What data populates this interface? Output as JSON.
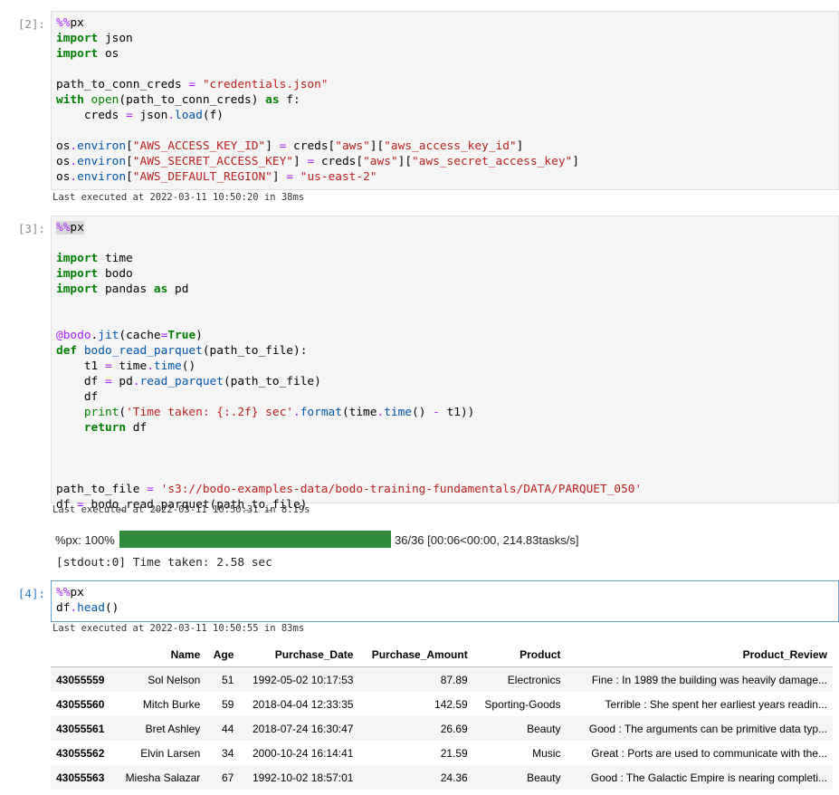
{
  "cells": [
    {
      "prompt": "[2]:",
      "lines": [
        [
          {
            "t": "%%",
            "c": "magic"
          },
          {
            "t": "px"
          }
        ],
        [
          {
            "t": "import",
            "c": "kw"
          },
          {
            "t": " json"
          }
        ],
        [
          {
            "t": "import",
            "c": "kw"
          },
          {
            "t": " os"
          }
        ],
        [],
        [
          {
            "t": "path_to_conn_creds "
          },
          {
            "t": "=",
            "c": "op"
          },
          {
            "t": " "
          },
          {
            "t": "\"credentials.json\"",
            "c": "str"
          }
        ],
        [
          {
            "t": "with",
            "c": "kw"
          },
          {
            "t": " "
          },
          {
            "t": "open",
            "c": "kw2"
          },
          {
            "t": "(path_to_conn_creds) "
          },
          {
            "t": "as",
            "c": "kw"
          },
          {
            "t": " f:"
          }
        ],
        [
          {
            "t": "    creds "
          },
          {
            "t": "=",
            "c": "op"
          },
          {
            "t": " json"
          },
          {
            "t": ".",
            "c": "op"
          },
          {
            "t": "load",
            "c": "attr"
          },
          {
            "t": "(f)"
          }
        ],
        [],
        [
          {
            "t": "os"
          },
          {
            "t": ".",
            "c": "op"
          },
          {
            "t": "environ",
            "c": "attr"
          },
          {
            "t": "["
          },
          {
            "t": "\"AWS_ACCESS_KEY_ID\"",
            "c": "str"
          },
          {
            "t": "] "
          },
          {
            "t": "=",
            "c": "op"
          },
          {
            "t": " creds["
          },
          {
            "t": "\"aws\"",
            "c": "str"
          },
          {
            "t": "]["
          },
          {
            "t": "\"aws_access_key_id\"",
            "c": "str"
          },
          {
            "t": "]"
          }
        ],
        [
          {
            "t": "os"
          },
          {
            "t": ".",
            "c": "op"
          },
          {
            "t": "environ",
            "c": "attr"
          },
          {
            "t": "["
          },
          {
            "t": "\"AWS_SECRET_ACCESS_KEY\"",
            "c": "str"
          },
          {
            "t": "] "
          },
          {
            "t": "=",
            "c": "op"
          },
          {
            "t": " creds["
          },
          {
            "t": "\"aws\"",
            "c": "str"
          },
          {
            "t": "]["
          },
          {
            "t": "\"aws_secret_access_key\"",
            "c": "str"
          },
          {
            "t": "]"
          }
        ],
        [
          {
            "t": "os"
          },
          {
            "t": ".",
            "c": "op"
          },
          {
            "t": "environ",
            "c": "attr"
          },
          {
            "t": "["
          },
          {
            "t": "\"AWS_DEFAULT_REGION\"",
            "c": "str"
          },
          {
            "t": "] "
          },
          {
            "t": "=",
            "c": "op"
          },
          {
            "t": " "
          },
          {
            "t": "\"us-east-2\"",
            "c": "str"
          }
        ]
      ],
      "exec": "Last executed at 2022-03-11 10:50:20 in 38ms"
    },
    {
      "prompt": "[3]:",
      "lines": [
        [
          {
            "t": "%%",
            "c": "magic-hl"
          },
          {
            "t": "px",
            "c": "plain-hl"
          }
        ],
        [],
        [
          {
            "t": "import",
            "c": "kw"
          },
          {
            "t": " time"
          }
        ],
        [
          {
            "t": "import",
            "c": "kw"
          },
          {
            "t": " bodo"
          }
        ],
        [
          {
            "t": "import",
            "c": "kw"
          },
          {
            "t": " pandas "
          },
          {
            "t": "as",
            "c": "kw"
          },
          {
            "t": " pd"
          }
        ],
        [],
        [],
        [
          {
            "t": "@bodo",
            "c": "magic"
          },
          {
            "t": "."
          },
          {
            "t": "jit",
            "c": "attr"
          },
          {
            "t": "(cache"
          },
          {
            "t": "=",
            "c": "op"
          },
          {
            "t": "True",
            "c": "kw"
          },
          {
            "t": ")"
          }
        ],
        [
          {
            "t": "def",
            "c": "kw"
          },
          {
            "t": " "
          },
          {
            "t": "bodo_read_parquet",
            "c": "fn"
          },
          {
            "t": "(path_to_file):"
          }
        ],
        [
          {
            "t": "    t1 "
          },
          {
            "t": "=",
            "c": "op"
          },
          {
            "t": " time"
          },
          {
            "t": ".",
            "c": "op"
          },
          {
            "t": "time",
            "c": "attr"
          },
          {
            "t": "()"
          }
        ],
        [
          {
            "t": "    df "
          },
          {
            "t": "=",
            "c": "op"
          },
          {
            "t": " pd"
          },
          {
            "t": ".",
            "c": "op"
          },
          {
            "t": "read_parquet",
            "c": "attr"
          },
          {
            "t": "(path_to_file)"
          }
        ],
        [
          {
            "t": "    df"
          }
        ],
        [
          {
            "t": "    "
          },
          {
            "t": "print",
            "c": "kw2"
          },
          {
            "t": "("
          },
          {
            "t": "'Time taken: {:.2f} sec'",
            "c": "str"
          },
          {
            "t": ".",
            "c": "op"
          },
          {
            "t": "format",
            "c": "attr"
          },
          {
            "t": "(time"
          },
          {
            "t": ".",
            "c": "op"
          },
          {
            "t": "time",
            "c": "attr"
          },
          {
            "t": "() "
          },
          {
            "t": "-",
            "c": "op"
          },
          {
            "t": " t1))"
          }
        ],
        [
          {
            "t": "    "
          },
          {
            "t": "return",
            "c": "kw"
          },
          {
            "t": " df"
          }
        ],
        [],
        [],
        [],
        [
          {
            "t": "path_to_file "
          },
          {
            "t": "=",
            "c": "op"
          },
          {
            "t": " "
          },
          {
            "t": "'s3://bodo-examples-data/bodo-training-fundamentals/DATA/PARQUET_050'",
            "c": "str"
          }
        ],
        [
          {
            "t": "df "
          },
          {
            "t": "=",
            "c": "op"
          },
          {
            "t": " bodo_read_parquet(path_to_file)"
          }
        ]
      ],
      "exec": "Last executed at 2022-03-11 10:50:31 in 8.19s"
    },
    {
      "prompt": "[4]:",
      "lines": [
        [
          {
            "t": "%%",
            "c": "magic"
          },
          {
            "t": "px"
          }
        ],
        [
          {
            "t": "df"
          },
          {
            "t": ".",
            "c": "op"
          },
          {
            "t": "head",
            "c": "attr"
          },
          {
            "t": "()"
          }
        ]
      ],
      "exec": "Last executed at 2022-03-11 10:50:55 in 83ms"
    }
  ],
  "progress": {
    "label": "%px: 100%",
    "fraction": 1.0,
    "stats": "36/36 [00:06<00:00, 214.83tasks/s]"
  },
  "stdout": "[stdout:0] Time taken: 2.58 sec",
  "table": {
    "columns": [
      "",
      "Name",
      "Age",
      "Purchase_Date",
      "Purchase_Amount",
      "Product",
      "Product_Review"
    ],
    "rows": [
      [
        "43055559",
        "Sol Nelson",
        "51",
        "1992-05-02 10:17:53",
        "87.89",
        "Electronics",
        "Fine : In 1989 the building was heavily damage..."
      ],
      [
        "43055560",
        "Mitch Burke",
        "59",
        "2018-04-04 12:33:35",
        "142.59",
        "Sporting-Goods",
        "Terrible : She spent her earliest years readin..."
      ],
      [
        "43055561",
        "Bret Ashley",
        "44",
        "2018-07-24 16:30:47",
        "26.69",
        "Beauty",
        "Good : The arguments can be primitive data typ..."
      ],
      [
        "43055562",
        "Elvin Larsen",
        "34",
        "2000-10-24 16:14:41",
        "21.59",
        "Music",
        "Great : Ports are used to communicate with the..."
      ],
      [
        "43055563",
        "Miesha Salazar",
        "67",
        "1992-10-02 18:57:01",
        "24.36",
        "Beauty",
        "Good : The Galactic Empire is nearing completi..."
      ]
    ]
  },
  "colors": {
    "progress_fill": "#2e8b3a",
    "active_border": "#66a3dc",
    "prompt_active": "#307fc1"
  }
}
